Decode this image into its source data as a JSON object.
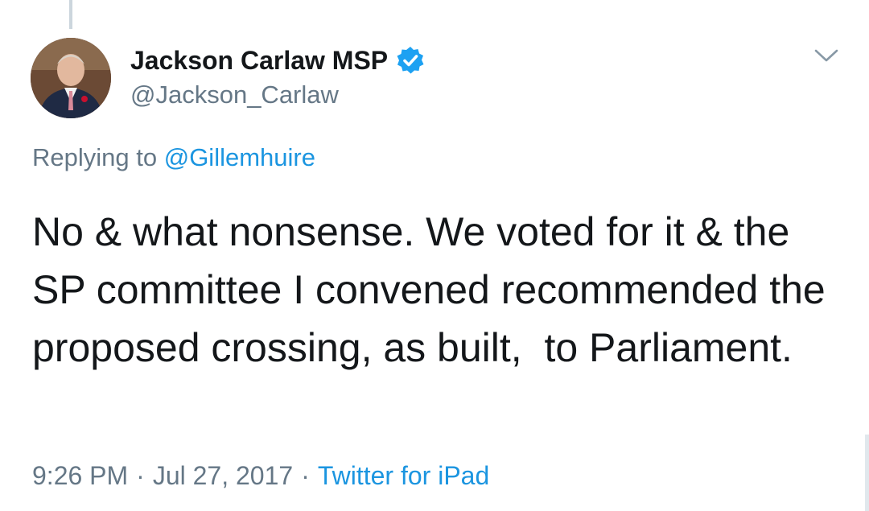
{
  "tweet": {
    "author": {
      "name": "Jackson Carlaw MSP",
      "handle": "@Jackson_Carlaw",
      "verified": true,
      "verified_icon": "verified-badge-icon"
    },
    "reply": {
      "prefix": "Replying to",
      "mention": "@Gillemhuire"
    },
    "text": "No & what nonsense. We voted for it & the SP committee I convened recommended the proposed crossing, as built,  to Parliament.",
    "time": "9:26 PM",
    "separator": "·",
    "date": "Jul 27, 2017",
    "source": "Twitter for iPad",
    "menu_icon": "chevron-down-icon"
  },
  "colors": {
    "text": "#14171a",
    "secondary": "#657786",
    "link": "#1b95e0",
    "verified": "#1da1f2",
    "thread_line": "#ccd6dd"
  }
}
